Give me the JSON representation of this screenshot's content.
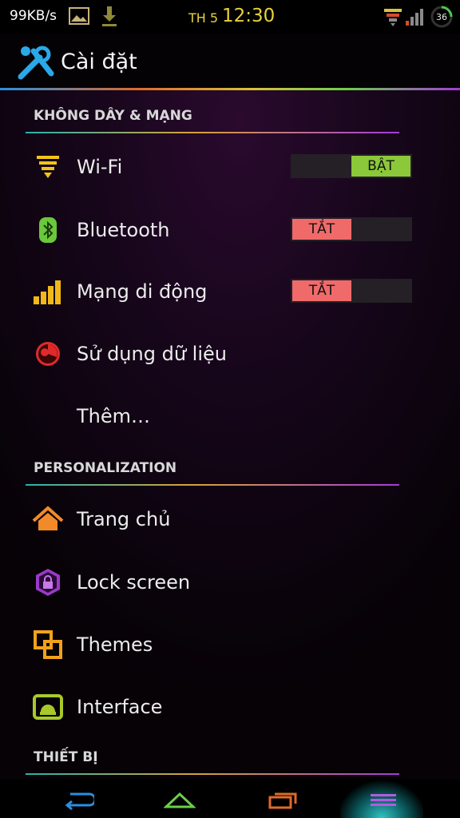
{
  "status_bar": {
    "speed": "99KB/s",
    "date": "TH 5",
    "time": "12:30",
    "battery": "36",
    "icons": [
      "gallery-icon",
      "download-icon",
      "wifi-icon",
      "signal-icon",
      "battery-icon"
    ]
  },
  "action_bar": {
    "title": "Cài đặt",
    "icon": "settings-tools-icon"
  },
  "sections": {
    "wireless": {
      "header": "KHÔNG DÂY & MẠNG",
      "items": {
        "wifi": {
          "label": "Wi-Fi",
          "toggle": "BẬT",
          "state": "on",
          "icon": "wifi-icon"
        },
        "bluetooth": {
          "label": "Bluetooth",
          "toggle": "TẮT",
          "state": "off",
          "icon": "bluetooth-icon"
        },
        "mobile": {
          "label": "Mạng di động",
          "toggle": "TẮT",
          "state": "off",
          "icon": "signal-bars-icon"
        },
        "data_usage": {
          "label": "Sử dụng dữ liệu",
          "icon": "data-usage-icon"
        },
        "more": {
          "label": "Thêm…"
        }
      }
    },
    "personalization": {
      "header": "PERSONALIZATION",
      "items": {
        "home": {
          "label": "Trang chủ",
          "icon": "home-icon"
        },
        "lock_screen": {
          "label": "Lock screen",
          "icon": "lock-icon"
        },
        "themes": {
          "label": "Themes",
          "icon": "themes-icon"
        },
        "interface": {
          "label": "Interface",
          "icon": "android-icon"
        }
      }
    },
    "device": {
      "header": "THIẾT BỊ"
    }
  },
  "nav_bar": {
    "buttons": [
      "back-icon",
      "home-icon",
      "recents-icon",
      "menu-icon"
    ]
  },
  "colors": {
    "accent_yellow": "#e8d23a",
    "toggle_on": "#8bc83a",
    "toggle_off": "#f06a6a",
    "nav_glow": "#2fc4c4"
  }
}
